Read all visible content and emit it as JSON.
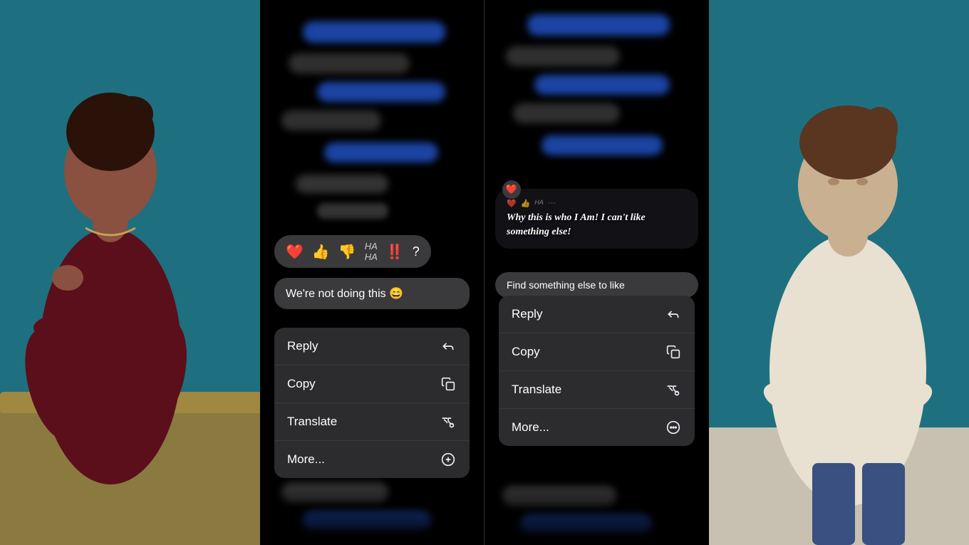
{
  "background": {
    "left_color": "#2a7a8c",
    "right_color": "#2a7a8c",
    "center_color": "#000000"
  },
  "phone_left": {
    "message_text": "We're not doing this 😄",
    "reaction_bar": {
      "icons": [
        "❤️",
        "👍",
        "👎",
        "😄",
        "‼️",
        "❓"
      ]
    },
    "context_menu": {
      "items": [
        {
          "label": "Reply",
          "icon": "reply"
        },
        {
          "label": "Copy",
          "icon": "copy"
        },
        {
          "label": "Translate",
          "icon": "translate"
        },
        {
          "label": "More...",
          "icon": "more"
        }
      ]
    }
  },
  "phone_right": {
    "callout_text": "Why this is who I Am! I can't like something else!",
    "find_label": "Find something else to like",
    "context_menu": {
      "items": [
        {
          "label": "Reply",
          "icon": "reply"
        },
        {
          "label": "Copy",
          "icon": "copy"
        },
        {
          "label": "Translate",
          "icon": "translate"
        },
        {
          "label": "More...",
          "icon": "more"
        }
      ]
    }
  }
}
